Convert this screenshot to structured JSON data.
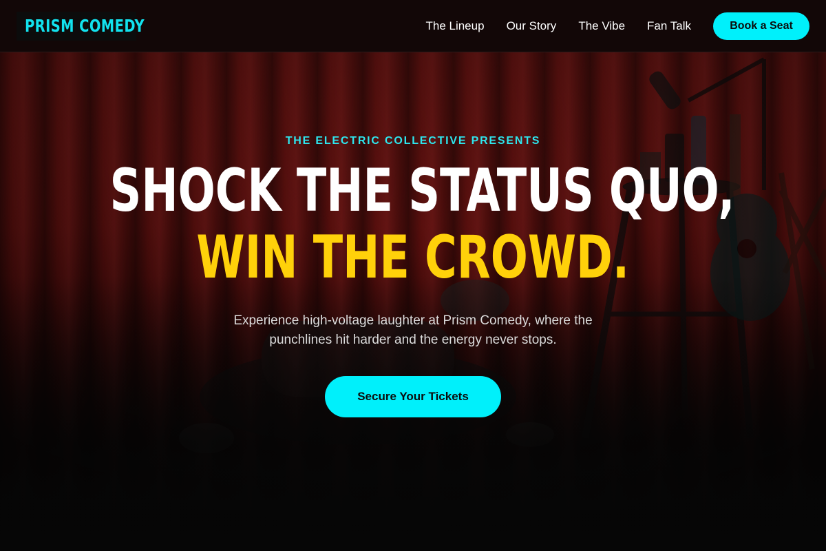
{
  "header": {
    "logo": "PRISM COMEDY",
    "nav": [
      "The Lineup",
      "Our Story",
      "The Vibe",
      "Fan Talk"
    ],
    "cta_label": "Book a Seat"
  },
  "hero": {
    "eyebrow": "THE ELECTRIC COLLECTIVE PRESENTS",
    "headline_line1": "SHOCK THE STATUS QUO,",
    "headline_line2": "WIN THE CROWD.",
    "subtext": "Experience high-voltage laughter at Prism Comedy, where the punchlines hit harder and the energy never stops.",
    "cta_label": "Secure Your Tickets",
    "background": "comedian-on-stage-photo"
  },
  "colors": {
    "accent_cyan": "#00f0fb",
    "accent_yellow": "#ffd10a",
    "header_bg": "#120707",
    "page_bg": "#0b0b0b"
  }
}
